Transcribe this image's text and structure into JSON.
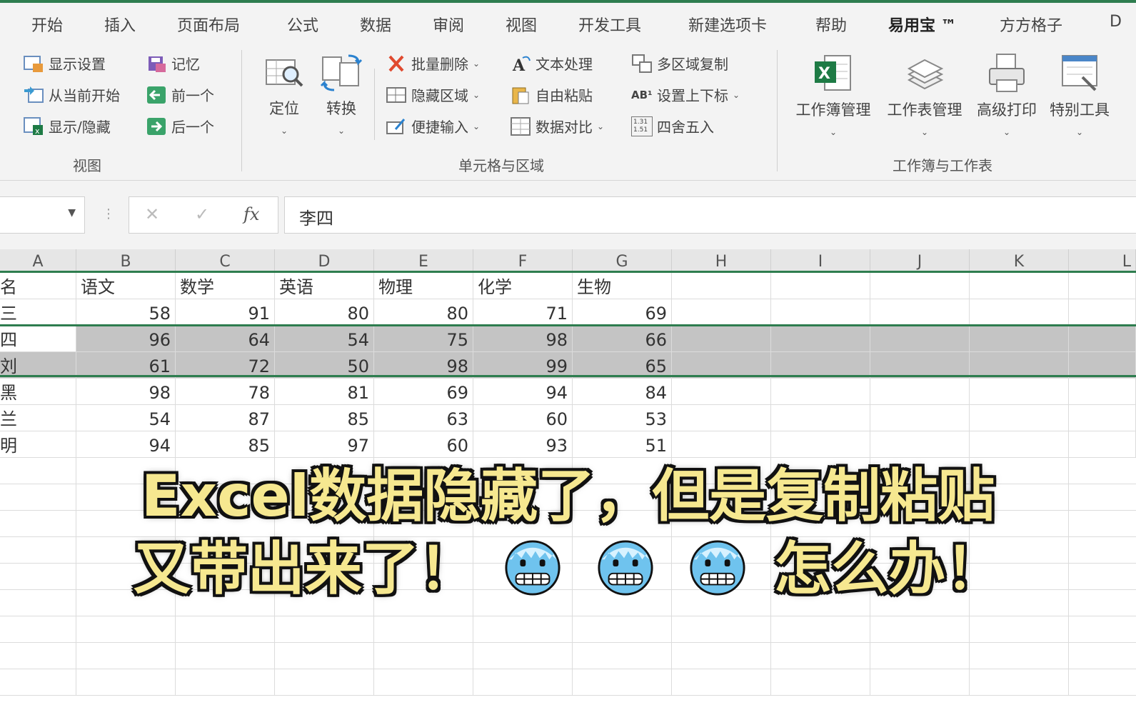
{
  "menu_tabs": [
    "开始",
    "插入",
    "页面布局",
    "公式",
    "数据",
    "审阅",
    "视图",
    "开发工具",
    "新建选项卡",
    "帮助",
    "易用宝 ™",
    "方方格子",
    "D"
  ],
  "active_tab": "易用宝 ™",
  "ribbon": {
    "view_group": {
      "label": "视图",
      "buttons": [
        "显示设置",
        "从当前开始",
        "显示/隐藏",
        "记忆",
        "前一个",
        "后一个"
      ]
    },
    "locate_label": "定位",
    "convert_label": "转换",
    "cells_group": {
      "label": "单元格与区域",
      "buttons": [
        "批量删除",
        "隐藏区域",
        "便捷输入",
        "文本处理",
        "自由粘贴",
        "数据对比",
        "多区域复制",
        "设置上下标",
        "四舍五入"
      ],
      "superscript_icon_text": "AB¹",
      "round_icon_text": "1.31 1.51"
    },
    "workbook_group": {
      "label": "工作簿与工作表",
      "buttons": [
        "工作簿管理",
        "工作表管理",
        "高级打印",
        "特别工具"
      ]
    }
  },
  "formula_bar": {
    "cancel_symbol": "✕",
    "enter_symbol": "✓",
    "fx_symbol": "fx",
    "value": "李四"
  },
  "sheet": {
    "columns": [
      "A",
      "B",
      "C",
      "D",
      "E",
      "F",
      "G",
      "H",
      "I",
      "J",
      "K",
      "L"
    ],
    "header_row": [
      "名",
      "语文",
      "数学",
      "英语",
      "物理",
      "化学",
      "生物"
    ],
    "rows": [
      {
        "name": "三",
        "values": [
          "58",
          "91",
          "80",
          "80",
          "71",
          "69"
        ],
        "hidden": false
      },
      {
        "name": "四",
        "values": [
          "96",
          "64",
          "54",
          "75",
          "98",
          "66"
        ],
        "hidden": true
      },
      {
        "name": "刘",
        "values": [
          "61",
          "72",
          "50",
          "98",
          "99",
          "65"
        ],
        "hidden": true
      },
      {
        "name": "黑",
        "values": [
          "98",
          "78",
          "81",
          "69",
          "94",
          "84"
        ],
        "hidden": false
      },
      {
        "name": "兰",
        "values": [
          "54",
          "87",
          "85",
          "63",
          "60",
          "53"
        ],
        "hidden": false
      },
      {
        "name": "明",
        "values": [
          "94",
          "85",
          "97",
          "60",
          "93",
          "51"
        ],
        "hidden": false
      }
    ]
  },
  "caption": {
    "line1": "Excel数据隐藏了，但是复制粘贴",
    "line2_start": "又带出来了！",
    "line2_end": "怎么办！",
    "emoji_name": "cold-face-emoji"
  },
  "colors": {
    "accent_green": "#2e7d4f",
    "caption_yellow": "#f6e890",
    "hidden_row_gray": "#c4c4c4"
  }
}
